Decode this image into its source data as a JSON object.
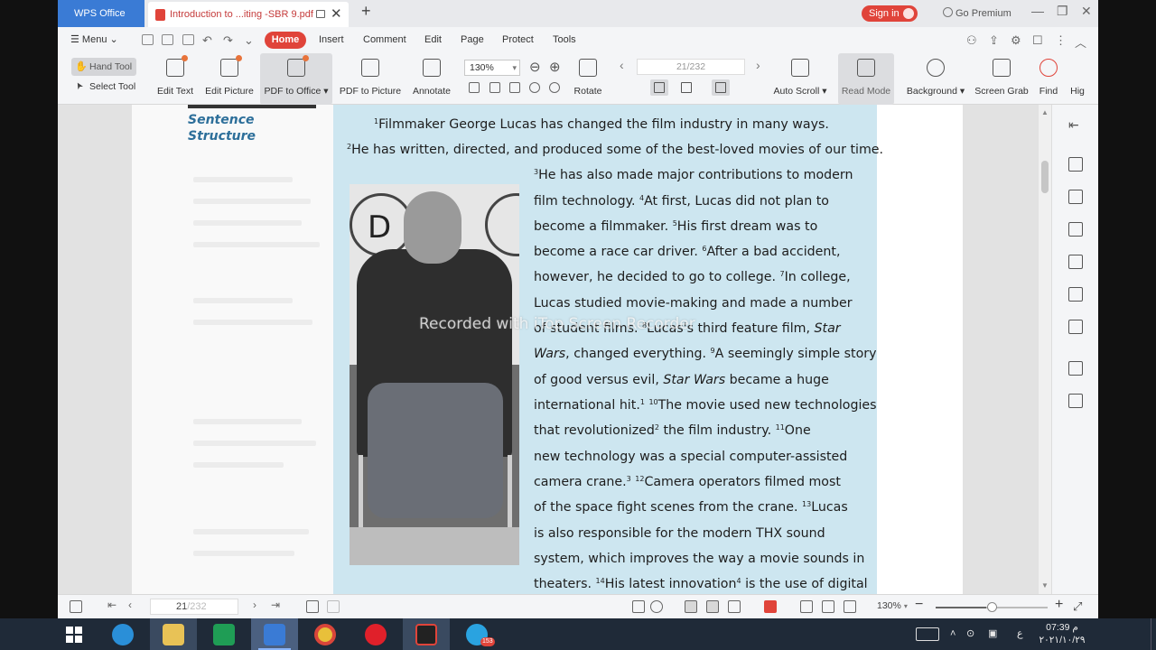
{
  "titlebar": {
    "app_tab": "WPS Office",
    "doc_tab": "Introduction to ...iting -SBR 9.pdf",
    "sign_in": "Sign in",
    "go_premium": "Go Premium"
  },
  "menubar": {
    "menu": "Menu",
    "tabs": [
      "Home",
      "Insert",
      "Comment",
      "Edit",
      "Page",
      "Protect",
      "Tools"
    ]
  },
  "toolbar": {
    "hand_tool": "Hand Tool",
    "select_tool": "Select Tool",
    "edit_text": "Edit Text",
    "edit_picture": "Edit Picture",
    "pdf_to_office": "PDF to Office",
    "pdf_to_picture": "PDF to Picture",
    "annotate": "Annotate",
    "zoom_value": "130%",
    "rotate": "Rotate",
    "page_current": "21",
    "page_total": "/232",
    "auto_scroll": "Auto Scroll",
    "read_mode": "Read Mode",
    "background": "Background",
    "screen_grab": "Screen Grab",
    "find": "Find",
    "highlight": "Hig"
  },
  "document": {
    "section_title_1": "Sentence",
    "section_title_2": "Structure",
    "watermark": "Recorded with iTop Screen Recorder",
    "photo_letter": "D",
    "lines": {
      "l1_sup": "1",
      "l1": "Filmmaker George Lucas has changed the film industry in many ways.",
      "l2_sup": "2",
      "l2": "He has written, directed, and produced some of the best-loved movies of our time.",
      "l3_sup": "3",
      "l3": "He has also made major contributions to modern",
      "l4a": "film technology. ",
      "l4_sup": "4",
      "l4b": "At first, Lucas did not plan to",
      "l5a": "become a filmmaker. ",
      "l5_sup": "5",
      "l5b": "His first dream was to",
      "l6a": "become a race car driver. ",
      "l6_sup": "6",
      "l6b": "After a bad accident,",
      "l7a": "however, he decided to go to college. ",
      "l7_sup": "7",
      "l7b": "In college,",
      "l8": "Lucas studied movie-making and made a number",
      "l9a": "of student films. ",
      "l9_sup": "8",
      "l9b": "Lucas's third feature film, ",
      "l9c": "Star",
      "l10a": "Wars",
      "l10b": ", changed everything. ",
      "l10_sup": "9",
      "l10c": "A seemingly simple story",
      "l11a": "of good versus evil, ",
      "l11b": "Star Wars",
      "l11c": " became a huge",
      "l12a": "international hit.",
      "l12_sup1": "1",
      "l12_sup": "10",
      "l12b": "The movie used new technologies",
      "l13a": "that revolutionized",
      "l13_sup1": "2",
      "l13b": " the film industry. ",
      "l13_sup": "11",
      "l13c": "One",
      "l14": "new technology was a special computer-assisted",
      "l15a": "camera crane.",
      "l15_sup1": "3",
      "l15_sup": "12",
      "l15b": "Camera operators filmed most",
      "l16a": "of the space fight scenes from the crane. ",
      "l16_sup": "13",
      "l16b": "Lucas",
      "l17": "is also responsible for the modern THX sound",
      "l18": "system, which improves the way a movie sounds in",
      "l19a": "theaters. ",
      "l19_sup": "14",
      "l19b": "His latest innovation",
      "l19_sup1": "4",
      "l19c": " is the use of digital"
    }
  },
  "statusbar": {
    "page_current": "21",
    "page_total": "/232",
    "zoom": "130%"
  },
  "taskbar": {
    "telegram_badge": "153",
    "lang": "ع",
    "time": "07:39 م",
    "date": "٢٠٢١/١٠/٢٩"
  },
  "colors": {
    "accent": "#e0443a",
    "wps_blue": "#3a7bd5",
    "page_blue": "#cde6f0",
    "heading_blue": "#2d6f9a"
  }
}
